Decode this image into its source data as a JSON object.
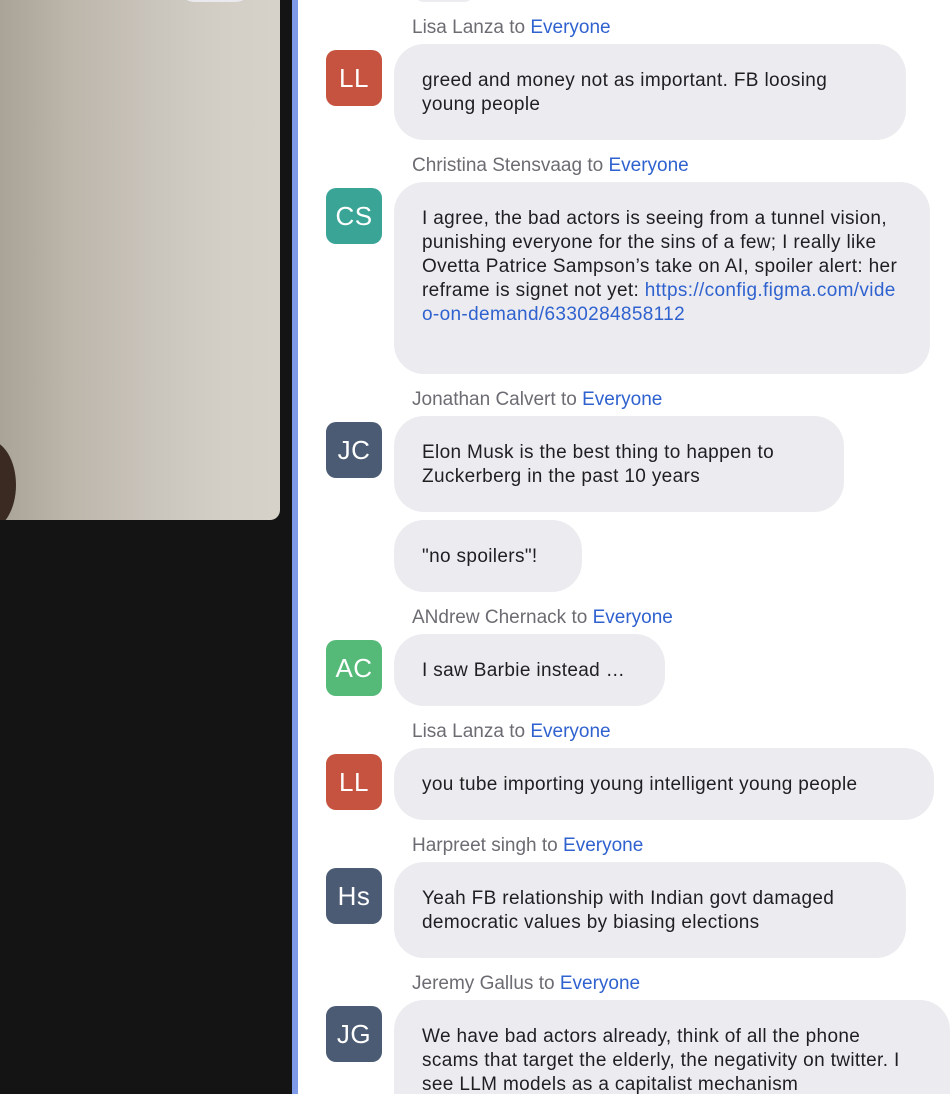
{
  "colors": {
    "avatar_ll": "#c5533f",
    "avatar_cs": "#3aa497",
    "avatar_dark": "#4b5b73",
    "avatar_ac": "#55ba78",
    "link": "#2f62cf",
    "bubble_bg": "#ececf0",
    "divider": "#7f9ae8"
  },
  "chat": {
    "messages": [
      {
        "sender": "Lisa Lanza",
        "to": "to",
        "recipient": "Everyone",
        "initials": "LL",
        "text": "greed and money not as important.  FB loosing young people"
      },
      {
        "sender": "Christina Stensvaag",
        "to": "to",
        "recipient": "Everyone",
        "initials": "CS",
        "text": "I agree, the bad actors is seeing from a tunnel vision, punishing everyone for the sins of a few; I really like Ovetta Patrice Sampson’s take on AI, spoiler alert: her reframe is signet not yet: ",
        "link": "https://config.figma.com/video-on-demand/6330284858112"
      },
      {
        "sender": "Jonathan Calvert",
        "to": "to",
        "recipient": "Everyone",
        "initials": "JC",
        "text": "Elon Musk is the best thing to happen to Zuckerberg in the past 10 years",
        "text2": "\"no spoilers\"!"
      },
      {
        "sender": "ANdrew Chernack",
        "to": "to",
        "recipient": "Everyone",
        "initials": "AC",
        "text": "I saw Barbie instead …"
      },
      {
        "sender": "Lisa Lanza",
        "to": "to",
        "recipient": "Everyone",
        "initials": "LL",
        "text": "you tube importing young intelligent young people"
      },
      {
        "sender": "Harpreet singh",
        "to": "to",
        "recipient": "Everyone",
        "initials": "Hs",
        "text": "Yeah FB relationship with Indian govt damaged democratic values by biasing elections"
      },
      {
        "sender": "Jeremy Gallus",
        "to": "to",
        "recipient": "Everyone",
        "initials": "JG",
        "text": "We have bad actors already, think of all the phone scams that target the elderly, the negativity on twitter. I see LLM models as a capitalist mechanism"
      }
    ]
  }
}
